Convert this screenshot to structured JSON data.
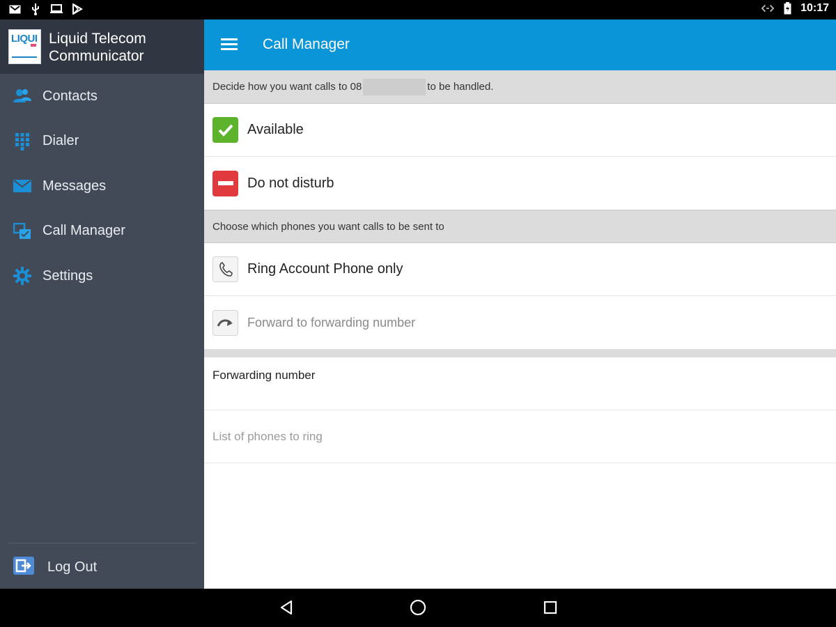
{
  "status_bar": {
    "time": "10:17",
    "left_icons": [
      "gmail-icon",
      "usb-icon",
      "laptop-icon",
      "play-store-icon"
    ],
    "right_icons": [
      "data-sync-icon",
      "battery-icon"
    ]
  },
  "drawer": {
    "app_name_line1": "Liquid Telecom",
    "app_name_line2": "Communicator",
    "logo_text": "LIQUI",
    "items": [
      {
        "label": "Contacts",
        "icon": "contacts-icon"
      },
      {
        "label": "Dialer",
        "icon": "dialpad-icon"
      },
      {
        "label": "Messages",
        "icon": "envelope-icon"
      },
      {
        "label": "Call Manager",
        "icon": "call-manager-icon"
      },
      {
        "label": "Settings",
        "icon": "gear-icon"
      }
    ],
    "logout_label": "Log Out"
  },
  "appbar": {
    "title": "Call Manager"
  },
  "content": {
    "section1_prefix": "Decide how you want calls to 08",
    "section1_suffix": "to be handled.",
    "options": [
      {
        "label": "Available",
        "icon": "check-icon",
        "color": "#5db32b"
      },
      {
        "label": "Do not disturb",
        "icon": "minus-icon",
        "color": "#e0393e"
      }
    ],
    "section2_header": "Choose which phones you want calls to be sent to",
    "phone_options": [
      {
        "label": "Ring Account Phone only",
        "icon": "phone-icon"
      },
      {
        "label": "Forward to forwarding number",
        "icon": "forward-arrow-icon"
      }
    ],
    "forwarding_number_label": "Forwarding number",
    "phones_list_label": "List of phones to ring"
  },
  "colors": {
    "accent": "#0a95d8",
    "drawer_bg": "#414a56",
    "drawer_header_bg": "#303742"
  }
}
